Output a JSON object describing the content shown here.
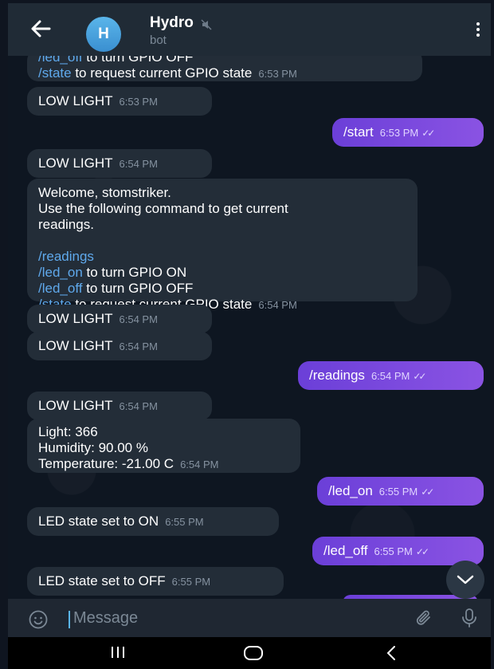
{
  "header": {
    "back_icon": "arrow-left-icon",
    "avatar_letter": "H",
    "title": "Hydro",
    "subtitle": "bot",
    "menu_icon": "kebab-menu-icon"
  },
  "messages": {
    "m1": {
      "line1_cmd": "/led_off",
      "line1_text": " to turn GPIO OFF",
      "line2_cmd": "/state",
      "line2_text": " to request current GPIO state",
      "time": "6:53 PM"
    },
    "m2": {
      "text": "LOW LIGHT",
      "time": "6:53 PM"
    },
    "m3": {
      "text": "/start",
      "time": "6:53 PM"
    },
    "m4": {
      "text": "LOW LIGHT",
      "time": "6:54 PM"
    },
    "m5": {
      "l1": "Welcome, stomstriker.",
      "l2": "Use the following command to get current",
      "l3": "readings.",
      "c1": "/readings",
      "c2": "/led_on",
      "t2": " to turn GPIO ON",
      "c3": "/led_off",
      "t3": " to turn GPIO OFF",
      "c4": "/state",
      "t4": " to request current GPIO state",
      "time": "6:54 PM"
    },
    "m6": {
      "text": "LOW LIGHT",
      "time": "6:54 PM"
    },
    "m7": {
      "text": "LOW LIGHT",
      "time": "6:54 PM"
    },
    "m8": {
      "text": "/readings",
      "time": "6:54 PM"
    },
    "m9": {
      "text": "LOW LIGHT",
      "time": "6:54 PM"
    },
    "m10": {
      "l1": "Light: 366",
      "l2": "Humidity: 90.00 %",
      "l3": "Temperature: -21.00 C",
      "time": "6:54 PM"
    },
    "m11": {
      "text": "/led_on",
      "time": "6:55 PM"
    },
    "m12": {
      "text": "LED state set to ON",
      "time": "6:55 PM"
    },
    "m13": {
      "text": "/led_off",
      "time": "6:55 PM"
    },
    "m14": {
      "text": "LED state set to OFF",
      "time": "6:55 PM"
    }
  },
  "input": {
    "placeholder": "Message",
    "emoji_icon": "smiley-icon",
    "attach_icon": "paperclip-icon",
    "mic_icon": "microphone-icon"
  },
  "colors": {
    "header": "#202b36",
    "incoming": "#232d38",
    "outgoing": "#7b4ae0",
    "command": "#5fa9ec",
    "background": "#0e1621"
  }
}
